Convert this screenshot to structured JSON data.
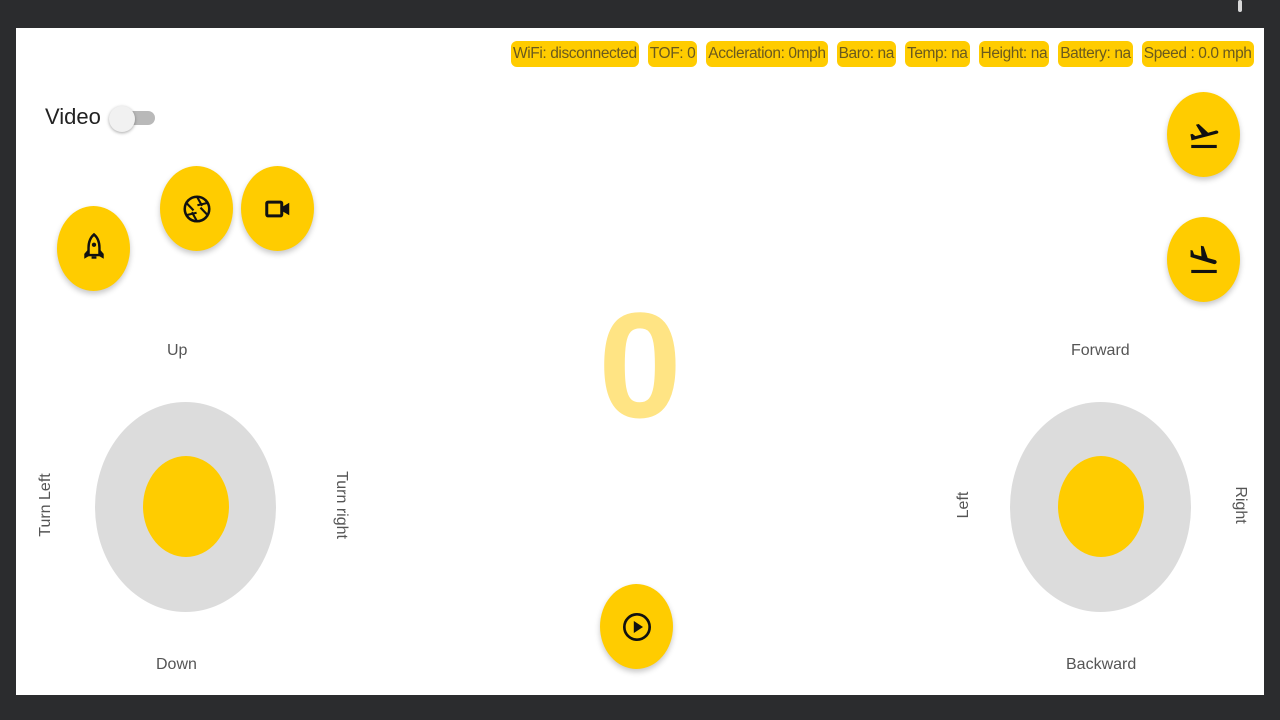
{
  "status": [
    "WiFi: disconnected",
    "TOF: 0",
    "Accleration: 0mph",
    "Baro: na",
    "Temp: na",
    "Height: na",
    "Battery: na",
    "Speed : 0.0 mph"
  ],
  "video": {
    "label": "Video",
    "enabled": false
  },
  "counter": "0",
  "left_joystick": {
    "up": "Up",
    "down": "Down",
    "left": "Turn Left",
    "right": "Turn right"
  },
  "right_joystick": {
    "up": "Forward",
    "down": "Backward",
    "left": "Left",
    "right": "Right"
  },
  "icons": {
    "launch": "rocket-icon",
    "photo": "camera-shutter-icon",
    "record": "video-camera-icon",
    "takeoff": "flight-takeoff-icon",
    "land": "flight-land-icon",
    "play": "play-circle-icon"
  },
  "colors": {
    "accent": "#ffcc00",
    "counter": "#ffe484",
    "pad": "#dcdcdc",
    "background": "#ffffff"
  }
}
